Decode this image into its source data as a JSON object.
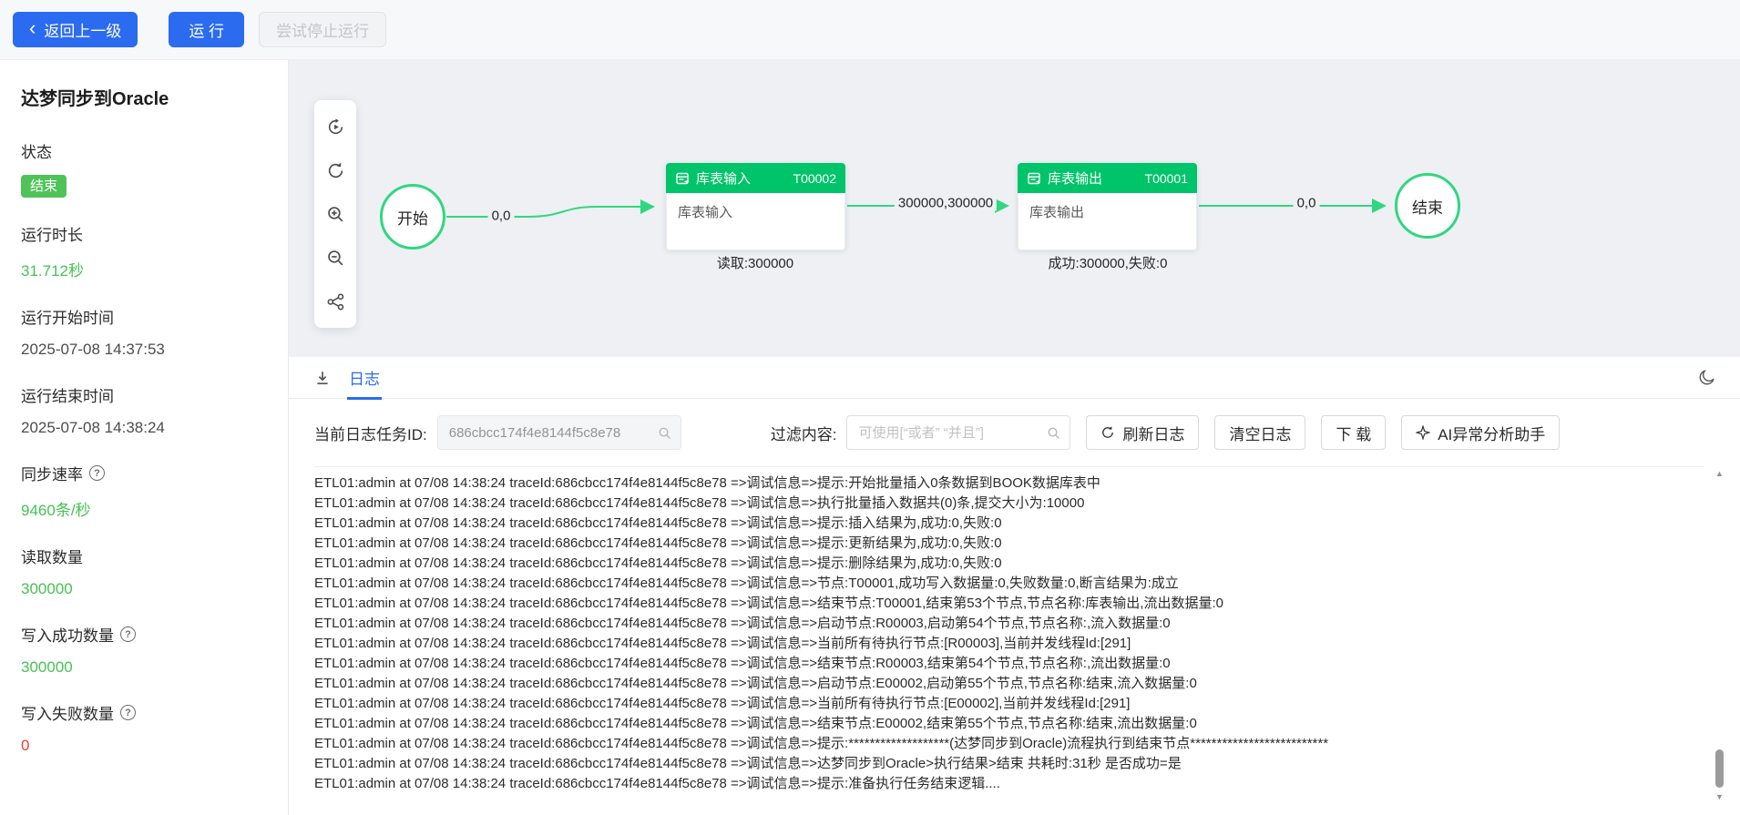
{
  "colors": {
    "accent_blue": "#2b6bf0",
    "node_header_green": "#00c46a",
    "edge_green": "#30d780",
    "badge_green": "#4fc35a",
    "value_green": "#47c254",
    "value_red": "#f04134",
    "canvas_bg": "#eef0f3"
  },
  "icons": {
    "back_chevron": "‹",
    "help_question": "?",
    "scrollbar_up": "▲",
    "scrollbar_down": "▼"
  },
  "toolbar": {
    "back_label": "返回上一级",
    "run_label": "运 行",
    "stop_label": "尝试停止运行"
  },
  "sidebar": {
    "title": "达梦同步到Oracle",
    "sections": [
      {
        "label": "状态",
        "value": "结束"
      },
      {
        "label": "运行时长",
        "value": "31.712秒"
      },
      {
        "label": "运行开始时间",
        "value": "2025-07-08 14:37:53"
      },
      {
        "label": "运行结束时间",
        "value": "2025-07-08 14:38:24"
      },
      {
        "label": "同步速率",
        "value": "9460条/秒"
      },
      {
        "label": "读取数量",
        "value": "300000"
      },
      {
        "label": "写入成功数量",
        "value": "300000"
      },
      {
        "label": "写入失败数量",
        "value": "0"
      }
    ]
  },
  "canvas": {
    "start_label": "开始",
    "end_label": "结束",
    "edge_labels": [
      "0,0",
      "300000,300000",
      "0,0"
    ],
    "nodes": [
      {
        "title": "库表输入",
        "id": "T00002",
        "body": "库表输入",
        "caption": "读取:300000"
      },
      {
        "title": "库表输出",
        "id": "T00001",
        "body": "库表输出",
        "caption": "成功:300000,失败:0"
      }
    ]
  },
  "log_panel": {
    "tab": "日志",
    "task_id_label": "当前日志任务ID:",
    "task_id": "686cbcc174f4e8144f5c8e78",
    "filter_label": "过滤内容:",
    "filter_placeholder": "可使用[“或者” “并且”]",
    "buttons": {
      "refresh": "刷新日志",
      "clear": "清空日志",
      "download": "下 载",
      "ai": "AI异常分析助手"
    },
    "lines": [
      "ETL01:admin at 07/08 14:38:24 traceId:686cbcc174f4e8144f5c8e78 =>调试信息=>提示:开始批量插入0条数据到BOOK数据库表中",
      "ETL01:admin at 07/08 14:38:24 traceId:686cbcc174f4e8144f5c8e78 =>调试信息=>执行批量插入数据共(0)条,提交大小为:10000",
      "ETL01:admin at 07/08 14:38:24 traceId:686cbcc174f4e8144f5c8e78 =>调试信息=>提示:插入结果为,成功:0,失败:0",
      "ETL01:admin at 07/08 14:38:24 traceId:686cbcc174f4e8144f5c8e78 =>调试信息=>提示:更新结果为,成功:0,失败:0",
      "ETL01:admin at 07/08 14:38:24 traceId:686cbcc174f4e8144f5c8e78 =>调试信息=>提示:删除结果为,成功:0,失败:0",
      "ETL01:admin at 07/08 14:38:24 traceId:686cbcc174f4e8144f5c8e78 =>调试信息=>节点:T00001,成功写入数据量:0,失败数量:0,断言结果为:成立",
      "ETL01:admin at 07/08 14:38:24 traceId:686cbcc174f4e8144f5c8e78 =>调试信息=>结束节点:T00001,结束第53个节点,节点名称:库表输出,流出数据量:0",
      "ETL01:admin at 07/08 14:38:24 traceId:686cbcc174f4e8144f5c8e78 =>调试信息=>启动节点:R00003,启动第54个节点,节点名称:,流入数据量:0",
      "ETL01:admin at 07/08 14:38:24 traceId:686cbcc174f4e8144f5c8e78 =>调试信息=>当前所有待执行节点:[R00003],当前并发线程Id:[291]",
      "ETL01:admin at 07/08 14:38:24 traceId:686cbcc174f4e8144f5c8e78 =>调试信息=>结束节点:R00003,结束第54个节点,节点名称:,流出数据量:0",
      "ETL01:admin at 07/08 14:38:24 traceId:686cbcc174f4e8144f5c8e78 =>调试信息=>启动节点:E00002,启动第55个节点,节点名称:结束,流入数据量:0",
      "ETL01:admin at 07/08 14:38:24 traceId:686cbcc174f4e8144f5c8e78 =>调试信息=>当前所有待执行节点:[E00002],当前并发线程Id:[291]",
      "ETL01:admin at 07/08 14:38:24 traceId:686cbcc174f4e8144f5c8e78 =>调试信息=>结束节点:E00002,结束第55个节点,节点名称:结束,流出数据量:0",
      "ETL01:admin at 07/08 14:38:24 traceId:686cbcc174f4e8144f5c8e78 =>调试信息=>提示:*******************(达梦同步到Oracle)流程执行到结束节点**************************",
      "ETL01:admin at 07/08 14:38:24 traceId:686cbcc174f4e8144f5c8e78 =>调试信息=>达梦同步到Oracle>执行结果>结束 共耗时:31秒 是否成功=是",
      "ETL01:admin at 07/08 14:38:24 traceId:686cbcc174f4e8144f5c8e78 =>调试信息=>提示:准备执行任务结束逻辑...."
    ]
  }
}
